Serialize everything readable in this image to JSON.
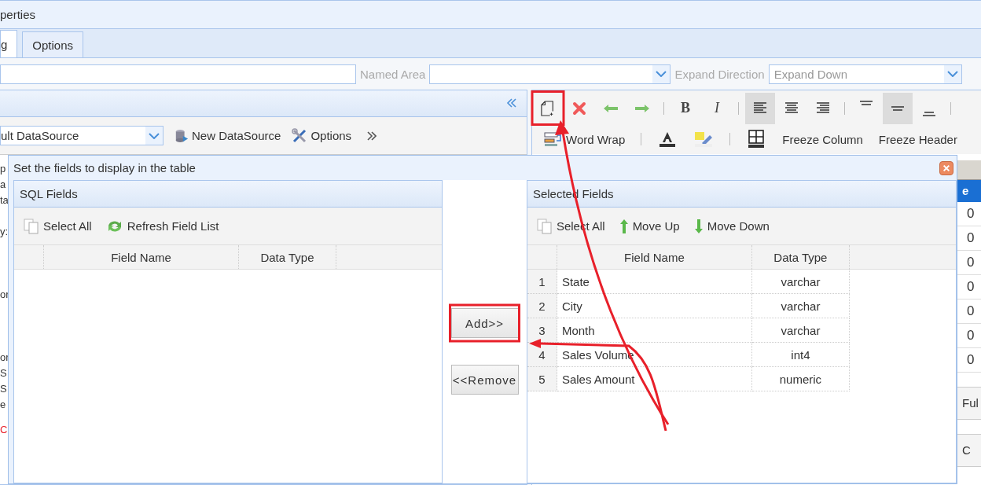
{
  "window": {
    "title": "perties"
  },
  "tabs": [
    {
      "label": "g",
      "selected": true
    },
    {
      "label": "Options",
      "selected": false
    }
  ],
  "form_row": [
    {
      "kind": "field"
    },
    {
      "kind": "label",
      "text": "Named Area"
    },
    {
      "kind": "select"
    },
    {
      "kind": "label",
      "text": "Expand Direction"
    },
    {
      "kind": "select",
      "value": "Expand Down"
    }
  ],
  "datasource_panel": {
    "select_value": "ult DataSource",
    "buttons": [
      {
        "label": "New DataSource"
      },
      {
        "label": "Options"
      }
    ]
  },
  "format_toolbar": {
    "row_1": [
      {
        "kind": "icon",
        "selected": false,
        "highlighted": true
      },
      {
        "kind": "icon",
        "selected": false,
        "highlighted": false
      },
      {
        "kind": "icon",
        "selected": false,
        "highlighted": false
      },
      {
        "kind": "icon",
        "selected": false,
        "highlighted": false
      },
      {
        "kind": "separator"
      },
      {
        "kind": "bold-glyph",
        "text": "B",
        "selected": false,
        "highlighted": false
      },
      {
        "kind": "italic-glyph",
        "text": "I",
        "selected": false,
        "highlighted": false
      },
      {
        "kind": "separator"
      },
      {
        "kind": "icon",
        "selected": true,
        "highlighted": false
      },
      {
        "kind": "icon",
        "selected": false,
        "highlighted": false
      },
      {
        "kind": "icon",
        "selected": false,
        "highlighted": false
      },
      {
        "kind": "separator"
      },
      {
        "kind": "icon",
        "selected": false,
        "highlighted": false
      },
      {
        "kind": "icon",
        "selected": true,
        "highlighted": false
      },
      {
        "kind": "icon",
        "selected": false,
        "highlighted": false
      },
      {
        "kind": "separator"
      }
    ],
    "row_2": [
      {
        "kind": "icon-label",
        "label": "Word Wrap"
      },
      {
        "kind": "separator"
      },
      {
        "kind": "icon"
      },
      {
        "kind": "icon"
      },
      {
        "kind": "separator"
      },
      {
        "kind": "icon"
      },
      {
        "kind": "label",
        "label": "Freeze Column"
      },
      {
        "kind": "label",
        "label": "Freeze Header"
      }
    ]
  },
  "background_left": [
    {
      "kind": "text",
      "text": "p"
    },
    {
      "kind": "text",
      "text": "a"
    },
    {
      "kind": "text",
      "text": "ta"
    },
    {
      "kind": "text",
      "text": "y:"
    },
    {
      "kind": "text",
      "text": "or"
    },
    {
      "kind": "text",
      "text": "or"
    },
    {
      "kind": "text",
      "text": "S"
    },
    {
      "kind": "text",
      "text": "S"
    },
    {
      "kind": "text",
      "text": "e"
    },
    {
      "kind": "error",
      "text": "C"
    }
  ],
  "background_grid": {
    "header": "e",
    "cells": [
      "0",
      "0",
      "0",
      "0",
      "0",
      "0",
      "0"
    ],
    "lower_cells": [
      "Ful",
      "C"
    ]
  },
  "dialog": {
    "title": "Set the fields to display in the table",
    "sql_fields": {
      "title": "SQL Fields",
      "tools": [
        {
          "label": "Select All"
        },
        {
          "label": "Refresh Field List"
        }
      ],
      "columns": [
        "Field Name",
        "Data Type"
      ]
    },
    "actions": [
      {
        "label": "Add>>",
        "highlighted": true
      },
      {
        "label": "<<Remove",
        "highlighted": false
      }
    ],
    "selected_fields": {
      "title": "Selected Fields",
      "tools": [
        {
          "label": "Select All"
        },
        {
          "label": "Move Up"
        },
        {
          "label": "Move Down"
        }
      ],
      "columns": [
        "Field Name",
        "Data Type"
      ],
      "rows": [
        {
          "index": "1",
          "name": "State",
          "type": "varchar"
        },
        {
          "index": "2",
          "name": "City",
          "type": "varchar"
        },
        {
          "index": "3",
          "name": "Month",
          "type": "varchar"
        },
        {
          "index": "4",
          "name": "Sales Volume",
          "type": "int4"
        },
        {
          "index": "5",
          "name": "Sales Amount",
          "type": "numeric"
        }
      ]
    }
  },
  "annotation_arrows": true
}
